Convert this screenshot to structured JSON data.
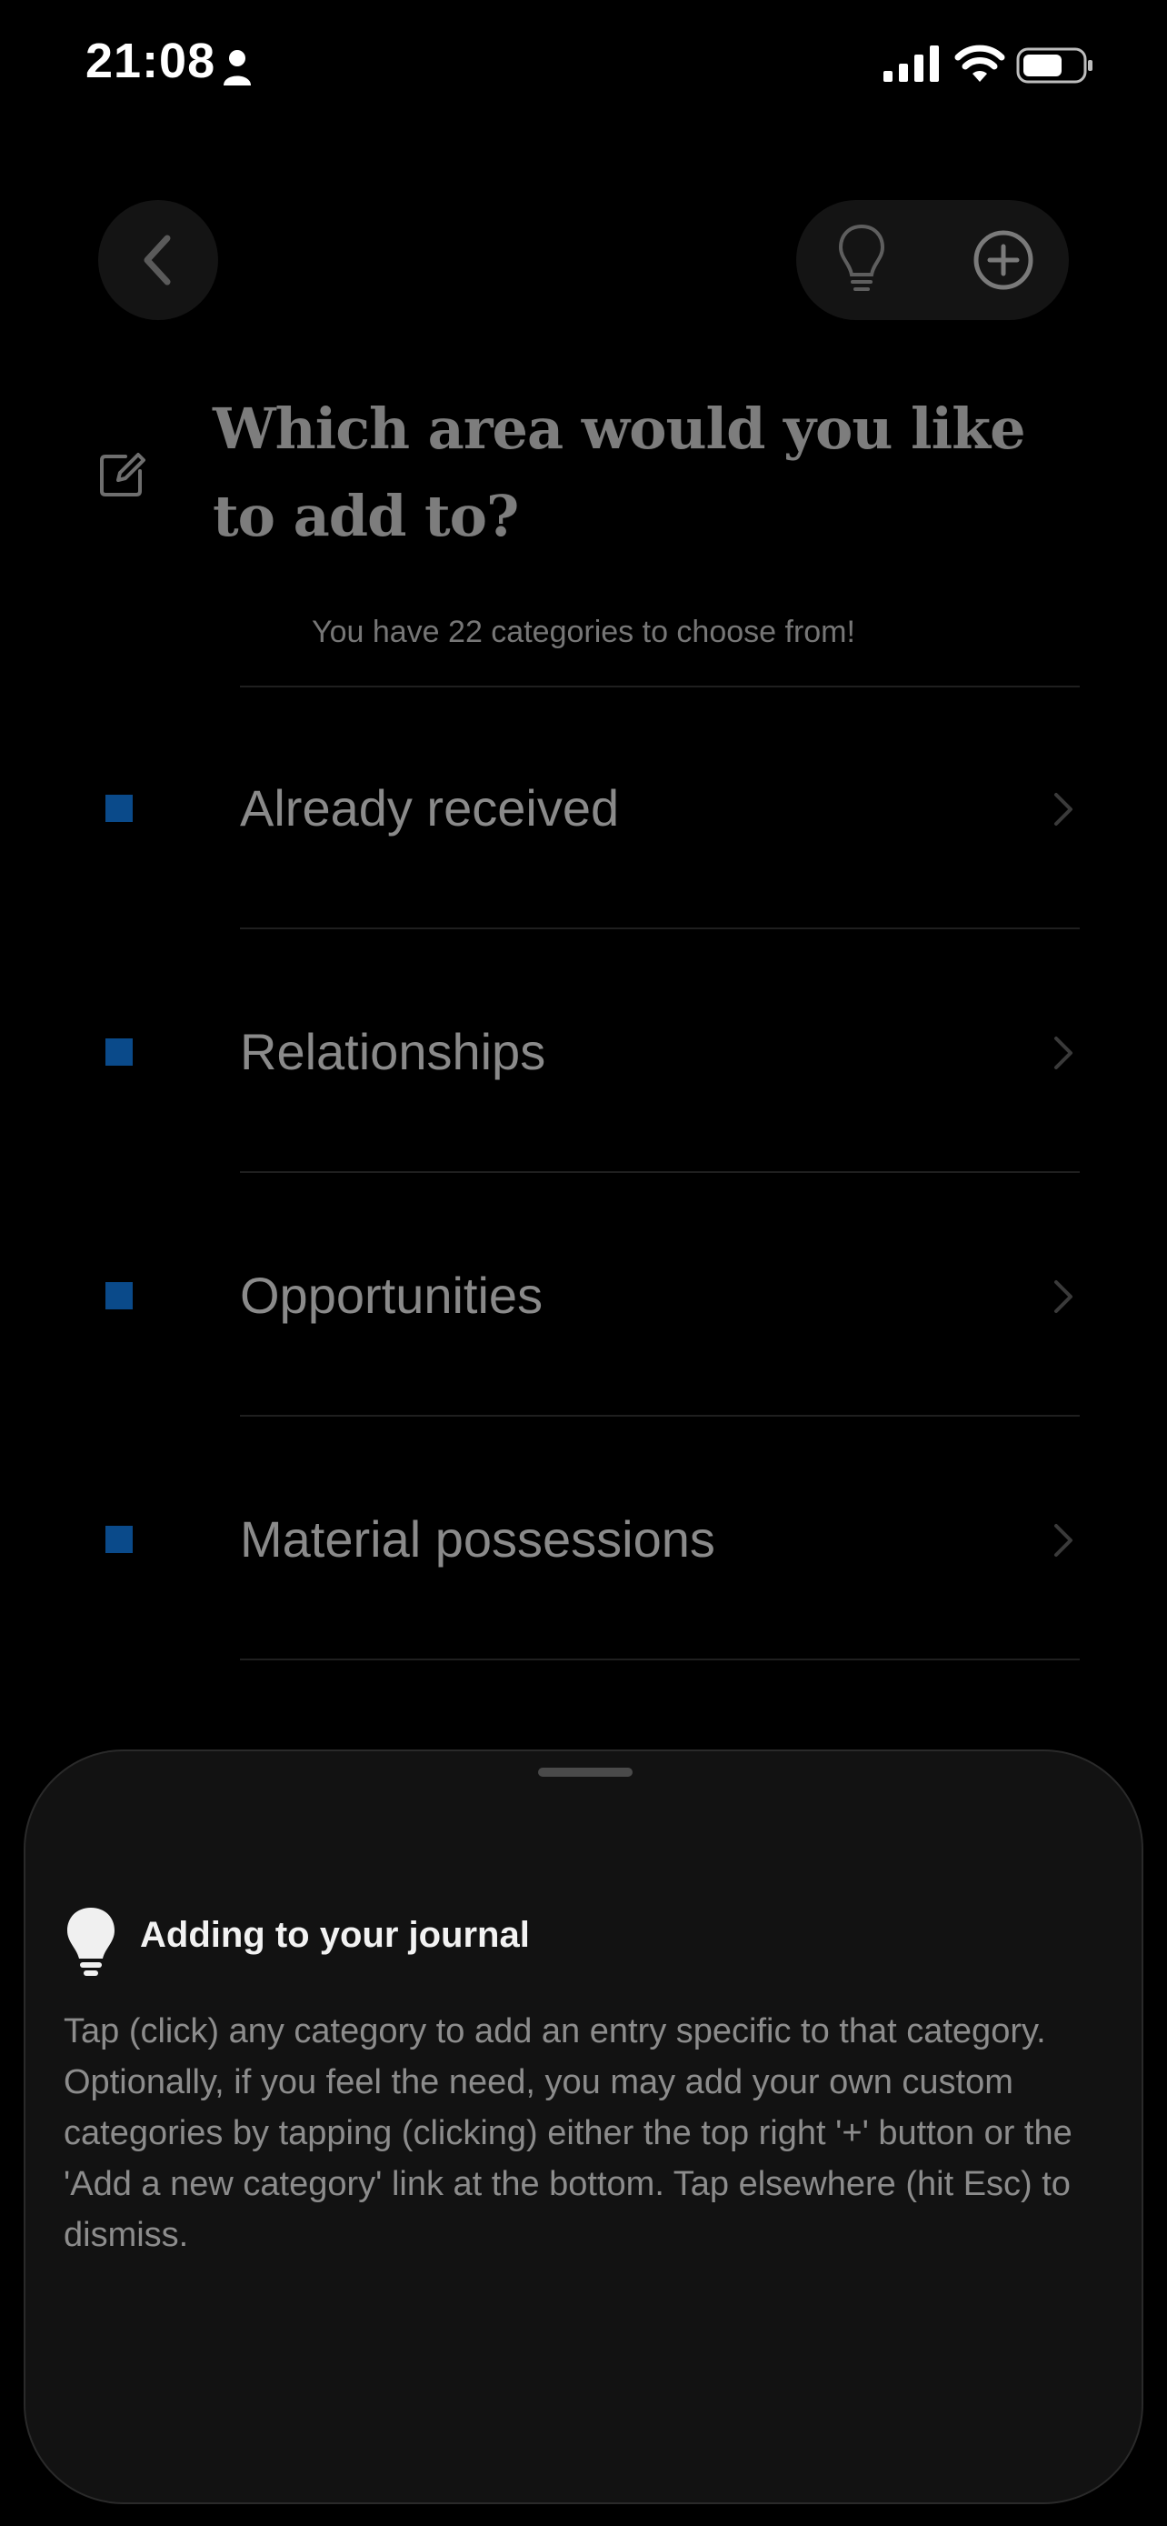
{
  "status_bar": {
    "time": "21:08"
  },
  "header": {
    "back_icon": "chevron-left-icon",
    "tips_icon": "lightbulb-icon",
    "add_icon": "plus-circle-icon"
  },
  "main": {
    "title": "Which area would you like to add to?",
    "subtitle": "You have 22 categories to choose from!",
    "categories": [
      {
        "label": "Already received",
        "color": "#0a4a8a"
      },
      {
        "label": "Relationships",
        "color": "#0a4a8a"
      },
      {
        "label": "Opportunities",
        "color": "#0a4a8a"
      },
      {
        "label": "Material possessions",
        "color": "#0a4a8a"
      }
    ]
  },
  "sheet": {
    "title": "Adding to your journal",
    "body": "Tap (click) any category to add an entry specific to that category. Optionally, if you feel the need, you may add your own custom categories by tapping (clicking) either the top right '+' button or the 'Add a new category' link at the bottom. Tap elsewhere (hit Esc) to dismiss."
  },
  "colors": {
    "background": "#000000",
    "accent_square": "#0a4a8a",
    "sheet_background": "#121212"
  }
}
